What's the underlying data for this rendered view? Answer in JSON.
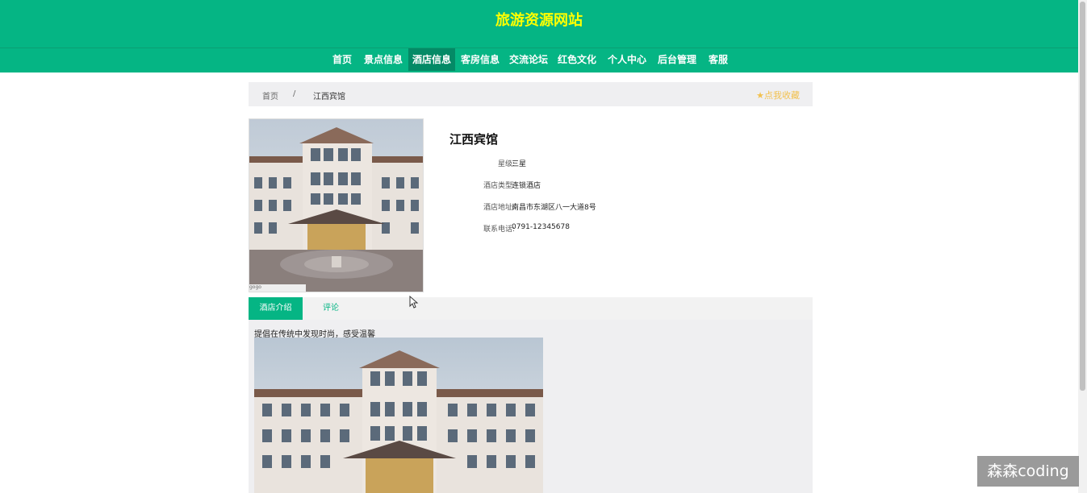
{
  "header": {
    "site_title": "旅游资源网站"
  },
  "nav": {
    "items": [
      {
        "label": "首页"
      },
      {
        "label": "景点信息"
      },
      {
        "label": "酒店信息",
        "active": true
      },
      {
        "label": "客房信息"
      },
      {
        "label": "交流论坛"
      },
      {
        "label": "红色文化"
      },
      {
        "label": "个人中心"
      },
      {
        "label": "后台管理"
      },
      {
        "label": "客服"
      }
    ]
  },
  "breadcrumb": {
    "home": "首页",
    "separator": "/",
    "current": "江西宾馆"
  },
  "favorite": {
    "icon": "star-icon",
    "label": "点我收藏"
  },
  "hotel": {
    "name": "江西宾馆",
    "image_caption": "gogo",
    "fields": [
      {
        "label": "星级:",
        "value": "三星"
      },
      {
        "label": "酒店类型:",
        "value": "连锁酒店"
      },
      {
        "label": "酒店地址:",
        "value": "南昌市东湖区八一大道8号"
      },
      {
        "label": "联系电话:",
        "value": "0791-12345678"
      }
    ]
  },
  "tabs": [
    {
      "label": "酒店介绍",
      "active": true
    },
    {
      "label": "评论"
    }
  ],
  "content": {
    "intro": "提倡在传统中发现时尚，感受温馨"
  },
  "watermark": "森森coding",
  "colors": {
    "brand": "#05b584",
    "title": "#ffff00",
    "favorite": "#f2c14e"
  }
}
